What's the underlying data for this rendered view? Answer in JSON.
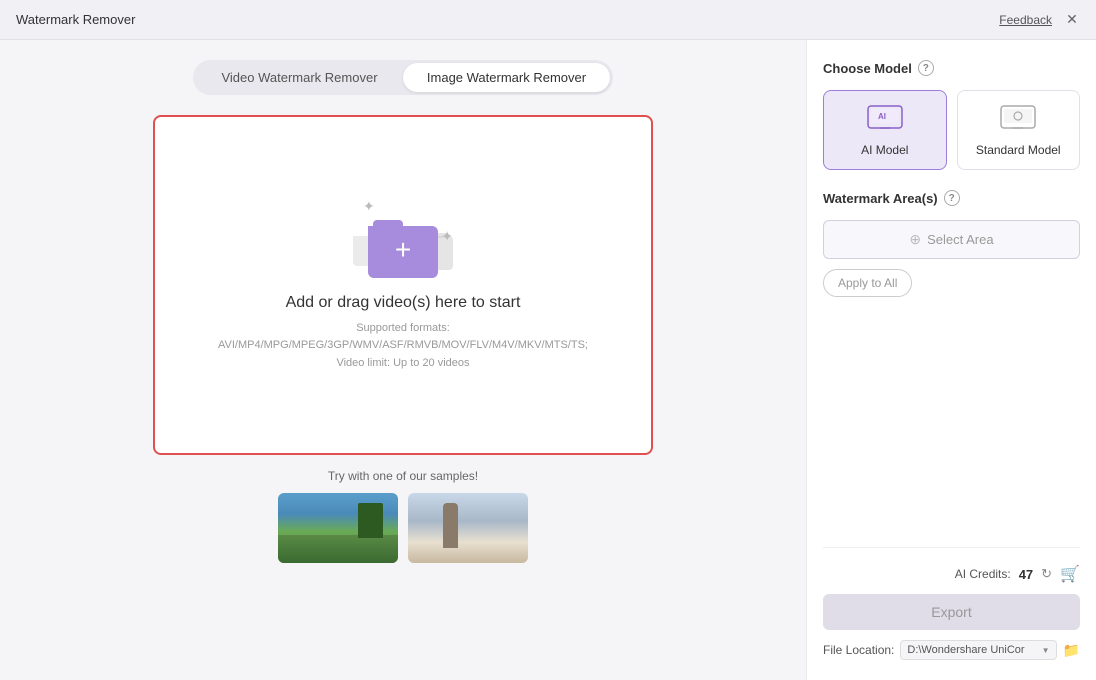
{
  "titlebar": {
    "title": "Watermark Remover",
    "feedback_label": "Feedback",
    "close_label": "✕"
  },
  "tabs": {
    "video_label": "Video Watermark Remover",
    "image_label": "Image Watermark Remover",
    "active": "image"
  },
  "dropzone": {
    "main_text": "Add or drag video(s) here to start",
    "sub_text_1": "Supported formats:",
    "sub_text_2": "AVI/MP4/MPG/MPEG/3GP/WMV/ASF/RMVB/MOV/FLV/M4V/MKV/MTS/TS;",
    "sub_text_3": "Video limit: Up to 20 videos"
  },
  "samples": {
    "label": "Try with one of our samples!"
  },
  "right_panel": {
    "choose_model_label": "Choose Model",
    "watermark_area_label": "Watermark Area(s)",
    "ai_model_label": "AI Model",
    "standard_model_label": "Standard Model",
    "select_area_label": "Select Area",
    "apply_all_label": "Apply to All",
    "credits_label": "AI Credits:",
    "credits_count": "47",
    "export_label": "Export",
    "file_location_label": "File Location:",
    "file_path": "D:\\Wondershare UniCor"
  }
}
